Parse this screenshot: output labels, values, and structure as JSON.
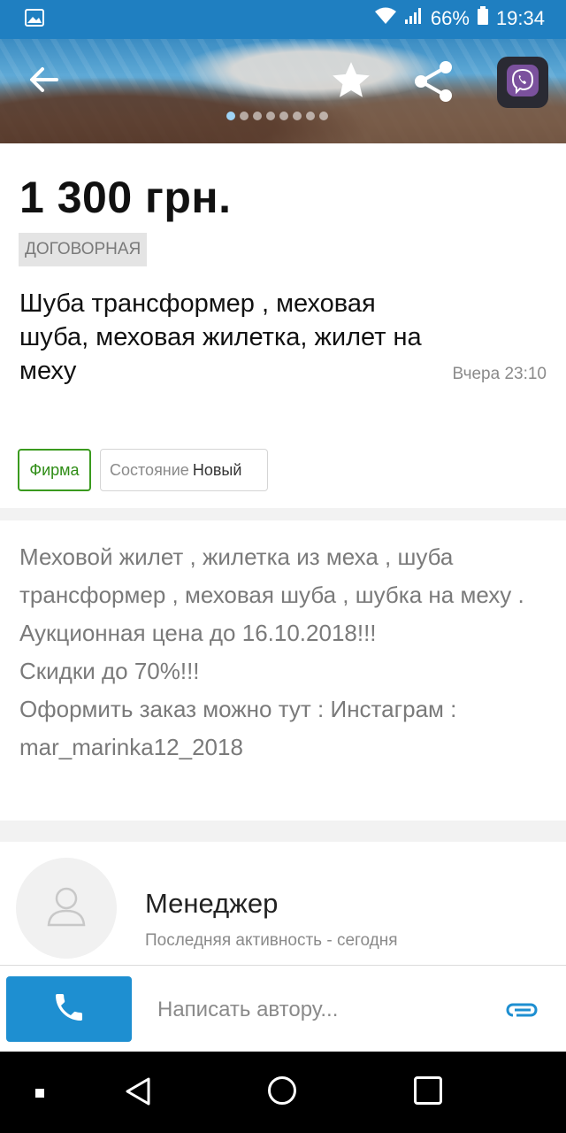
{
  "status_bar": {
    "battery": "66%",
    "time": "19:34",
    "icons": [
      "image-icon",
      "wifi-icon",
      "signal-icon",
      "battery-icon"
    ]
  },
  "hero": {
    "slides_count": 8,
    "active_slide": 1,
    "icons": [
      "back-arrow-icon",
      "star-icon",
      "share-icon",
      "viber-icon"
    ]
  },
  "listing": {
    "price": "1 300 грн.",
    "negotiable": "ДОГОВОРНАЯ",
    "title": "Шуба трансформер , меховая шуба, меховая жилетка, жилет на меху",
    "date": "Вчера 23:10",
    "tag_firm": "Фирма",
    "state_label": "Состояние",
    "state_value": "Новый"
  },
  "description": {
    "lines": [
      "Меховой жилет , жилетка из меха , шуба трансформер , меховая шуба , шубка на меху .",
      "Аукционная цена до 16.10.2018!!!",
      "Скидки до 70%!!!",
      "Оформить заказ можно тут : Инстаграм : mar_marinka12_2018"
    ]
  },
  "seller": {
    "name": "Менеджер",
    "activity": "Последняя активность - сегодня"
  },
  "actions": {
    "message_placeholder": "Написать автору...",
    "accent_color": "#1e8fd1"
  }
}
